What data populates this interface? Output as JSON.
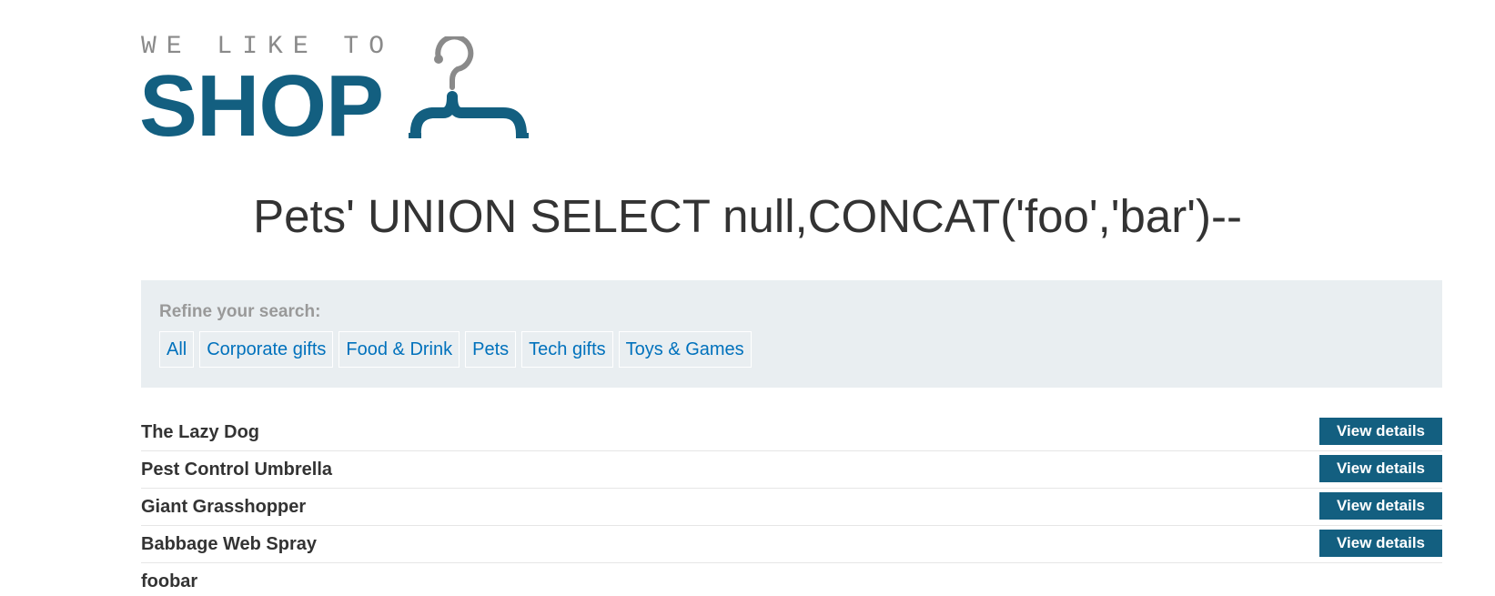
{
  "logo": {
    "tagline": "WE LIKE TO",
    "word": "SHOP",
    "brand_color": "#135f80",
    "tagline_color": "#8a8a8a"
  },
  "page_title": "Pets' UNION SELECT null,CONCAT('foo','bar')--",
  "filters": {
    "label": "Refine your search:",
    "items": [
      {
        "label": "All"
      },
      {
        "label": "Corporate gifts"
      },
      {
        "label": "Food & Drink"
      },
      {
        "label": "Pets"
      },
      {
        "label": "Tech gifts"
      },
      {
        "label": "Toys & Games"
      }
    ],
    "link_color": "#0071bc",
    "panel_color": "#e9eef1"
  },
  "products": [
    {
      "name": "The Lazy Dog",
      "button": "View details"
    },
    {
      "name": "Pest Control Umbrella",
      "button": "View details"
    },
    {
      "name": "Giant Grasshopper",
      "button": "View details"
    },
    {
      "name": "Babbage Web Spray",
      "button": "View details"
    },
    {
      "name": "foobar"
    }
  ]
}
